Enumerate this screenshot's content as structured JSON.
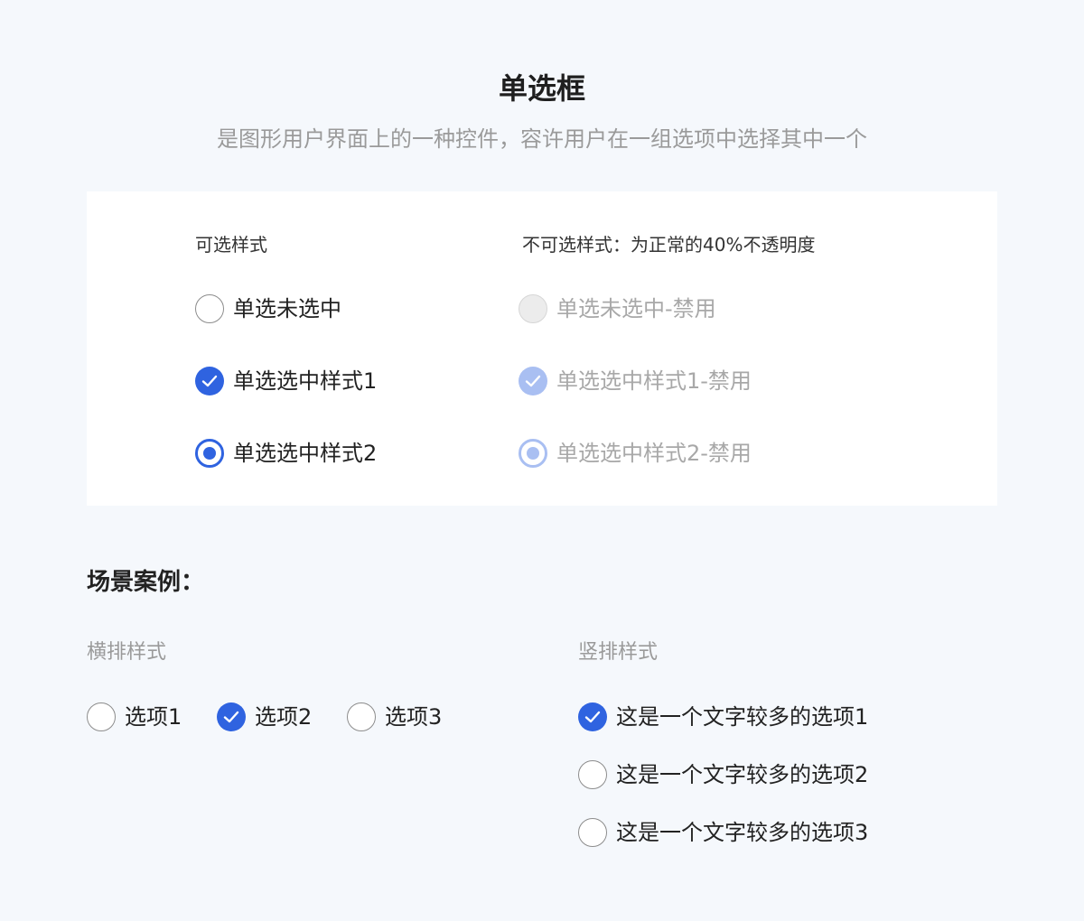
{
  "header": {
    "title": "单选框",
    "subtitle": "是图形用户界面上的一种控件，容许用户在一组选项中选择其中一个"
  },
  "demo": {
    "enabled_heading": "可选样式",
    "disabled_heading": "不可选样式：为正常的40%不透明度",
    "enabled_items": [
      {
        "label": "单选未选中",
        "state": "unchecked"
      },
      {
        "label": "单选选中样式1",
        "state": "checked-check"
      },
      {
        "label": "单选选中样式2",
        "state": "checked-dot"
      }
    ],
    "disabled_items": [
      {
        "label": "单选未选中-禁用",
        "state": "unchecked"
      },
      {
        "label": "单选选中样式1-禁用",
        "state": "checked-check"
      },
      {
        "label": "单选选中样式2-禁用",
        "state": "checked-dot"
      }
    ]
  },
  "examples": {
    "title": "场景案例：",
    "horizontal": {
      "heading": "横排样式",
      "options": [
        {
          "label": "选项1",
          "checked": false
        },
        {
          "label": "选项2",
          "checked": true
        },
        {
          "label": "选项3",
          "checked": false
        }
      ]
    },
    "vertical": {
      "heading": "竖排样式",
      "options": [
        {
          "label": "这是一个文字较多的选项1",
          "checked": true
        },
        {
          "label": "这是一个文字较多的选项2",
          "checked": false
        },
        {
          "label": "这是一个文字较多的选项3",
          "checked": false
        }
      ]
    }
  },
  "colors": {
    "accent": "#2f63e0",
    "accent_disabled": "#a9bff2",
    "background": "#f5f8fc",
    "card": "#ffffff"
  }
}
